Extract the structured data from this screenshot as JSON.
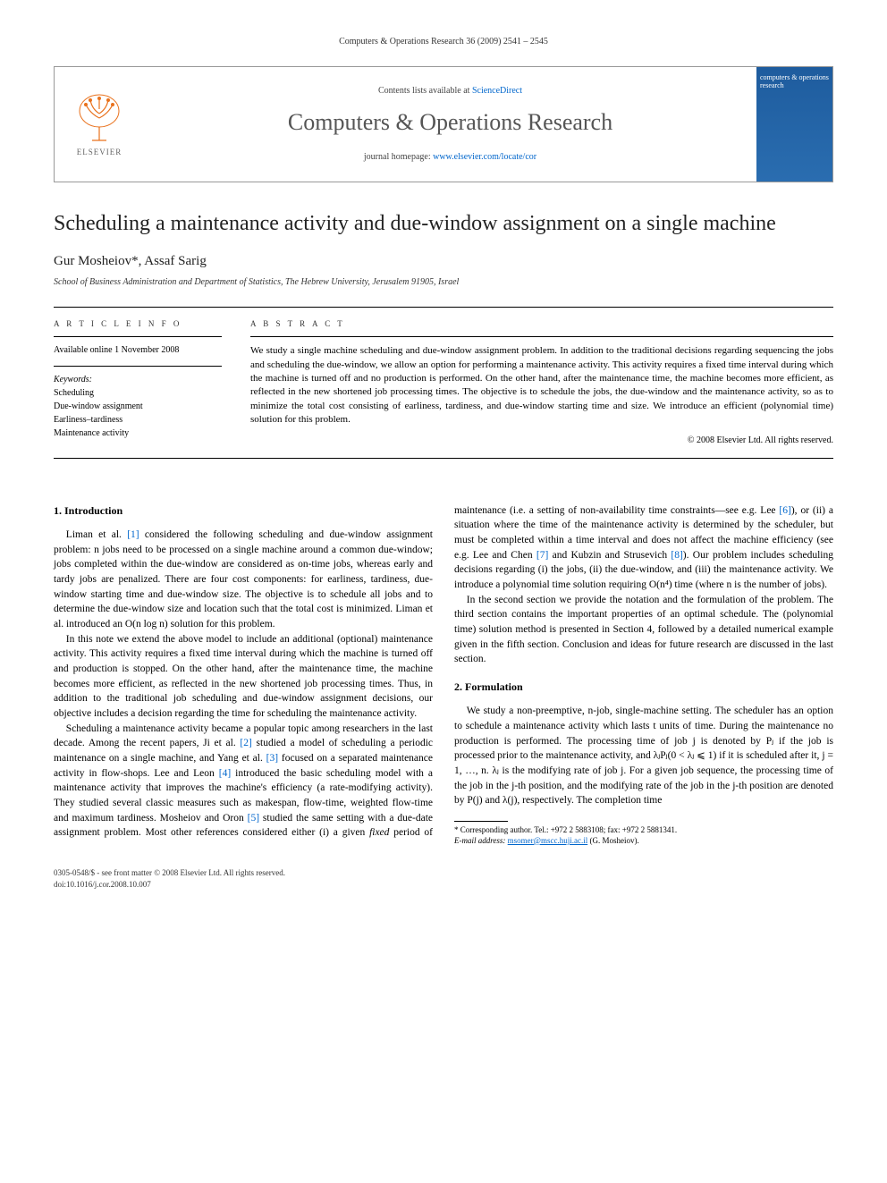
{
  "header": {
    "citation": "Computers & Operations Research 36 (2009) 2541 – 2545"
  },
  "journal_box": {
    "logo_text": "ELSEVIER",
    "contents_prefix": "Contents lists available at ",
    "contents_link": "ScienceDirect",
    "journal_name": "Computers & Operations Research",
    "homepage_prefix": "journal homepage: ",
    "homepage_url": "www.elsevier.com/locate/cor",
    "cover_title": "computers & operations research"
  },
  "article": {
    "title": "Scheduling a maintenance activity and due-window assignment on a single machine",
    "authors": "Gur Mosheiov*, Assaf Sarig",
    "affiliation": "School of Business Administration and Department of Statistics, The Hebrew University, Jerusalem 91905, Israel"
  },
  "info": {
    "heading": "A R T I C L E   I N F O",
    "available": "Available online 1 November 2008",
    "kw_heading": "Keywords:",
    "keywords": [
      "Scheduling",
      "Due-window assignment",
      "Earliness–tardiness",
      "Maintenance activity"
    ]
  },
  "abstract": {
    "heading": "A B S T R A C T",
    "text": "We study a single machine scheduling and due-window assignment problem. In addition to the traditional decisions regarding sequencing the jobs and scheduling the due-window, we allow an option for performing a maintenance activity. This activity requires a fixed time interval during which the machine is turned off and no production is performed. On the other hand, after the maintenance time, the machine becomes more efficient, as reflected in the new shortened job processing times. The objective is to schedule the jobs, the due-window and the maintenance activity, so as to minimize the total cost consisting of earliness, tardiness, and due-window starting time and size. We introduce an efficient (polynomial time) solution for this problem.",
    "copyright": "© 2008 Elsevier Ltd. All rights reserved."
  },
  "body": {
    "s1_heading": "1. Introduction",
    "s1_p1a": "Liman et al. ",
    "s1_p1_cite1": "[1]",
    "s1_p1b": " considered the following scheduling and due-window assignment problem: n jobs need to be processed on a single machine around a common due-window; jobs completed within the due-window are considered as on-time jobs, whereas early and tardy jobs are penalized. There are four cost components: for earliness, tardiness, due-window starting time and due-window size. The objective is to schedule all jobs and to determine the due-window size and location such that the total cost is minimized. Liman et al. introduced an O(n log n) solution for this problem.",
    "s1_p2": "In this note we extend the above model to include an additional (optional) maintenance activity. This activity requires a fixed time interval during which the machine is turned off and production is stopped. On the other hand, after the maintenance time, the machine becomes more efficient, as reflected in the new shortened job processing times. Thus, in addition to the traditional job scheduling and due-window assignment decisions, our objective includes a decision regarding the time for scheduling the maintenance activity.",
    "s1_p3a": "Scheduling a maintenance activity became a popular topic among researchers in the last decade. Among the recent papers, Ji et al. ",
    "s1_p3_cite2": "[2]",
    "s1_p3b": " studied a model of scheduling a periodic maintenance on a single machine, and Yang et al. ",
    "s1_p3_cite3": "[3]",
    "s1_p3c": " focused on a separated maintenance activity in flow-shops. Lee and Leon ",
    "s1_p3_cite4": "[4]",
    "s1_p3d": " introduced the basic scheduling model with a maintenance activity that improves the machine's efficiency (a rate-modifying activity). They studied several classic measures such as makespan, flow-time, weighted flow-time and maximum tardiness. Mosheiov and Oron ",
    "s1_p3_cite5": "[5]",
    "s1_p3e": " studied the same setting with a due-date assignment problem. Most other references considered either (i) a given ",
    "s1_p3_fixed": "fixed",
    "s1_p3f": " period of maintenance (i.e. a setting of non-availability time constraints—see e.g. Lee ",
    "s1_p3_cite6": "[6]",
    "s1_p3g": "), or (ii) a situation where the time of the maintenance activity is determined by the scheduler, but must be completed within a time interval and does not affect the machine efficiency (see e.g. Lee and Chen ",
    "s1_p3_cite7": "[7]",
    "s1_p3h": " and Kubzin and Strusevich ",
    "s1_p3_cite8": "[8]",
    "s1_p3i": "). Our problem includes scheduling decisions regarding (i) the jobs, (ii) the due-window, and (iii) the maintenance activity. We introduce a polynomial time solution requiring O(n⁴) time (where n is the number of jobs).",
    "s1_p4": "In the second section we provide the notation and the formulation of the problem. The third section contains the important properties of an optimal schedule. The (polynomial time) solution method is presented in Section 4, followed by a detailed numerical example given in the fifth section. Conclusion and ideas for future research are discussed in the last section.",
    "s2_heading": "2. Formulation",
    "s2_p1": "We study a non-preemptive, n-job, single-machine setting. The scheduler has an option to schedule a maintenance activity which lasts t units of time. During the maintenance no production is performed. The processing time of job j is denoted by Pⱼ if the job is processed prior to the maintenance activity, and λⱼPⱼ(0 < λⱼ ⩽ 1) if it is scheduled after it, j = 1, …, n. λⱼ is the modifying rate of job j. For a given job sequence, the processing time of the job in the j-th position, and the modifying rate of the job in the j-th position are denoted by P(j) and λ(j), respectively. The completion time"
  },
  "footnote": {
    "corr": "* Corresponding author. Tel.: +972 2 5883108; fax: +972 2 5881341.",
    "email_label": "E-mail address: ",
    "email": "msomer@mscc.huji.ac.il",
    "email_suffix": " (G. Mosheiov)."
  },
  "bottom": {
    "line1": "0305-0548/$ - see front matter © 2008 Elsevier Ltd. All rights reserved.",
    "line2": "doi:10.1016/j.cor.2008.10.007"
  }
}
